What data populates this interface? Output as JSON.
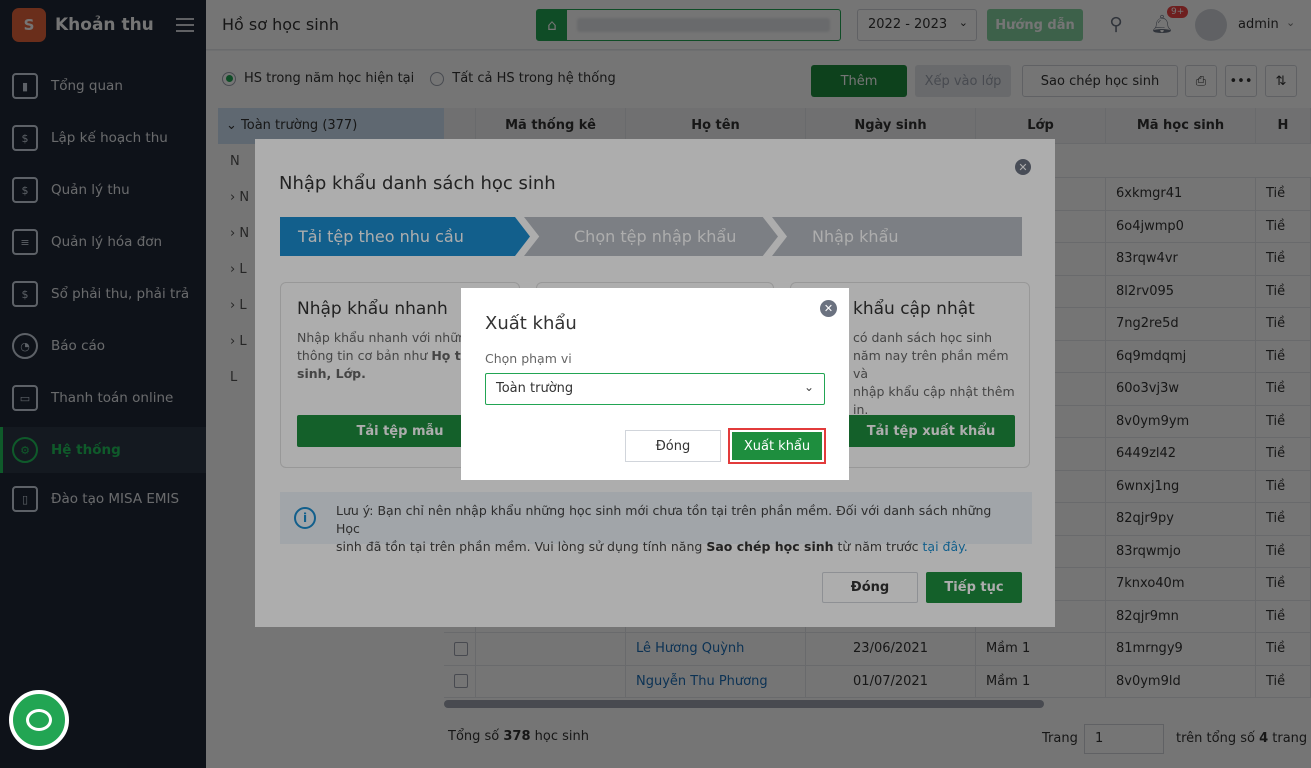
{
  "app": {
    "name": "Khoản thu"
  },
  "sidebar": {
    "items": [
      {
        "label": "Tổng quan",
        "icon": "chart-icon"
      },
      {
        "label": "Lập kế hoạch thu",
        "icon": "calendar-icon"
      },
      {
        "label": "Quản lý thu",
        "icon": "money-hand-icon"
      },
      {
        "label": "Quản lý hóa đơn",
        "icon": "invoice-icon"
      },
      {
        "label": "Sổ phải thu, phải trả",
        "icon": "ledger-icon"
      },
      {
        "label": "Báo cáo",
        "icon": "pie-chart-icon"
      },
      {
        "label": "Thanh toán online",
        "icon": "card-icon"
      },
      {
        "label": "Hệ thống",
        "icon": "gear-icon"
      },
      {
        "label": "Đào tạo MISA EMIS",
        "icon": "book-icon"
      }
    ],
    "active_index": 7
  },
  "topbar": {
    "title": "Hồ sơ học sinh",
    "year": "2022 - 2023",
    "guide_label": "Hướng dẫn",
    "notification_count": "9+",
    "user": "admin"
  },
  "main": {
    "radio_current": "HS trong năm học hiện tại",
    "radio_all": "Tất cả HS trong hệ thống",
    "btn_add": "Thêm",
    "btn_assign_class": "Xếp vào lớp",
    "btn_copy": "Sao chép học sinh",
    "tree_root": "Toàn trường (377)",
    "columns": [
      "Mã thống kê",
      "Họ tên",
      "Ngày sinh",
      "Lớp",
      "Mã học sinh",
      "H"
    ],
    "rows": [
      {
        "name": "",
        "dob": "",
        "class": "",
        "code": "6xkmgr41",
        "extra": "Tiề"
      },
      {
        "name": "",
        "dob": "",
        "class": "",
        "code": "6o4jwmp0",
        "extra": "Tiề"
      },
      {
        "name": "",
        "dob": "",
        "class": "",
        "code": "83rqw4vr",
        "extra": "Tiề"
      },
      {
        "name": "",
        "dob": "",
        "class": "",
        "code": "8l2rv095",
        "extra": "Tiề"
      },
      {
        "name": "",
        "dob": "",
        "class": "",
        "code": "7ng2re5d",
        "extra": "Tiề"
      },
      {
        "name": "",
        "dob": "",
        "class": "",
        "code": "6q9mdqmj",
        "extra": "Tiề"
      },
      {
        "name": "",
        "dob": "",
        "class": "",
        "code": "60o3vj3w",
        "extra": "Tiề"
      },
      {
        "name": "",
        "dob": "",
        "class": "",
        "code": "8v0ym9ym",
        "extra": "Tiề"
      },
      {
        "name": "",
        "dob": "",
        "class": "",
        "code": "6449zl42",
        "extra": "Tiề"
      },
      {
        "name": "",
        "dob": "",
        "class": "",
        "code": "6wnxj1ng",
        "extra": "Tiề"
      },
      {
        "name": "",
        "dob": "",
        "class": "",
        "code": "82qjr9py",
        "extra": "Tiề"
      },
      {
        "name": "",
        "dob": "",
        "class": "",
        "code": "83rqwmjo",
        "extra": "Tiề"
      },
      {
        "name": "",
        "dob": "",
        "class": "",
        "code": "7knxo40m",
        "extra": "Tiề"
      },
      {
        "name": "",
        "dob": "",
        "class": "",
        "code": "82qjr9mn",
        "extra": "Tiề"
      },
      {
        "name": "Lê Hương Quỳnh",
        "dob": "23/06/2021",
        "class": "Mầm 1",
        "code": "81mrngy9",
        "extra": "Tiề"
      },
      {
        "name": "Nguyễn Thu Phương",
        "dob": "01/07/2021",
        "class": "Mầm 1",
        "code": "8v0ym9ld",
        "extra": "Tiề"
      }
    ],
    "footer_prefix": "Tổng số",
    "footer_count": "378",
    "footer_suffix": "học sinh",
    "page_label": "Trang",
    "page_value": "1",
    "page_total_prefix": "trên tổng số",
    "page_total": "4",
    "page_total_suffix": "trang"
  },
  "import_modal": {
    "title": "Nhập khẩu danh sách học sinh",
    "steps": [
      "Tải tệp theo nhu cầu",
      "Chọn tệp nhập khẩu",
      "Nhập khẩu"
    ],
    "card1": {
      "title": "Nhập khẩu nhanh",
      "desc_1": "Nhập khẩu nhanh với những",
      "desc_2": "thông tin cơ bản như",
      "desc_bold_1": "Họ tê",
      "desc_bold_2": "sinh, Lớp.",
      "btn": "Tải tệp mẫu"
    },
    "card3": {
      "title": "khẩu cập nhật",
      "desc_1": "có danh sách học sinh",
      "desc_2": "năm nay trên phần mềm và",
      "desc_3": "nhập khẩu cập nhật thêm",
      "desc_4": "in.",
      "btn": "Tải tệp xuất khẩu"
    },
    "note_1": "Lưu ý: Bạn chỉ nên nhập khẩu những học sinh mới chưa tồn tại trên phần mềm. Đối với danh sách những Học",
    "note_2": "sinh đã tồn tại trên phần mềm. Vui lòng sử dụng tính năng",
    "note_bold": "Sao chép học sinh",
    "note_3": "từ năm trước",
    "note_link": "tại đây.",
    "btn_close": "Đóng",
    "btn_next": "Tiếp tục"
  },
  "export_modal": {
    "title": "Xuất khẩu",
    "scope_label": "Chọn phạm vi",
    "scope_value": "Toàn trường",
    "btn_cancel": "Đóng",
    "btn_export": "Xuất khẩu"
  },
  "colors": {
    "primary_green": "#1e8e3e",
    "step_blue": "#1b8dcf",
    "highlight_red": "#e23b3b"
  }
}
